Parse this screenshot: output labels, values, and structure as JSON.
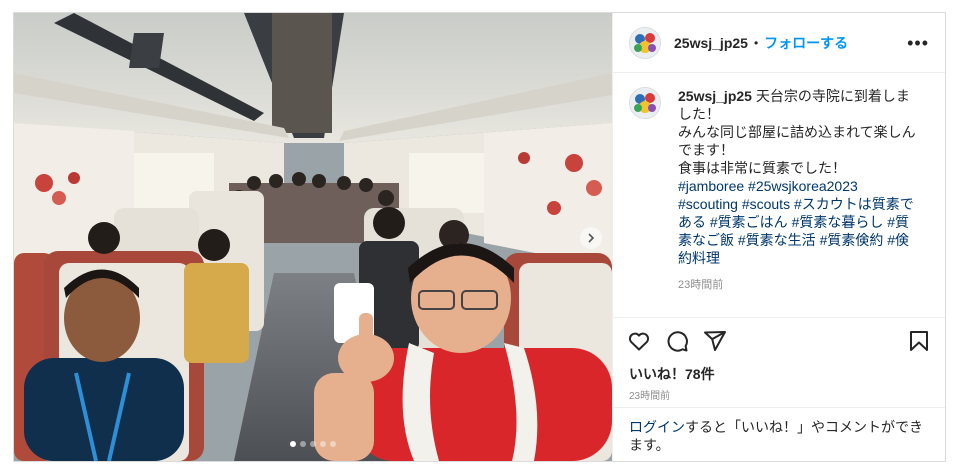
{
  "post": {
    "username": "25wsj_jp25",
    "separator": "•",
    "follow_label": "フォローする",
    "more_label": "•••"
  },
  "caption": {
    "username": "25wsj_jp25",
    "body": " 天台宗の寺院に到着しました！\nみんな同じ部屋に詰め込まれて楽しんでます！\n食事は非常に質素でした！\n",
    "tags": [
      {
        "text": "#jamboree",
        "after": " "
      },
      {
        "text": "#25wsjkorea2023",
        "after": "\n"
      },
      {
        "text": "#scouting",
        "after": " "
      },
      {
        "text": "#scouts",
        "after": " "
      },
      {
        "text": "#スカウトは質素である",
        "after": " "
      },
      {
        "text": "#質素ごはん",
        "after": " "
      },
      {
        "text": "#質素な暮らし",
        "after": " "
      },
      {
        "text": "#質素なご飯",
        "after": " "
      },
      {
        "text": "#質素な生活",
        "after": " "
      },
      {
        "text": "#質素倹約",
        "after": " "
      },
      {
        "text": "#倹約料理",
        "after": ""
      }
    ],
    "time": "23時間前"
  },
  "engagement": {
    "likes": "いいね！78件",
    "time": "23時間前"
  },
  "login_prompt": {
    "link": "ログイン",
    "text": "すると「いいね！」やコメントができます。"
  },
  "carousel": {
    "current_slide": 1,
    "total_slides": 5
  },
  "icons": {
    "like": "heart-icon",
    "comment": "comment-icon",
    "share": "share-icon",
    "save": "bookmark-icon",
    "next": "chevron-right-icon"
  }
}
